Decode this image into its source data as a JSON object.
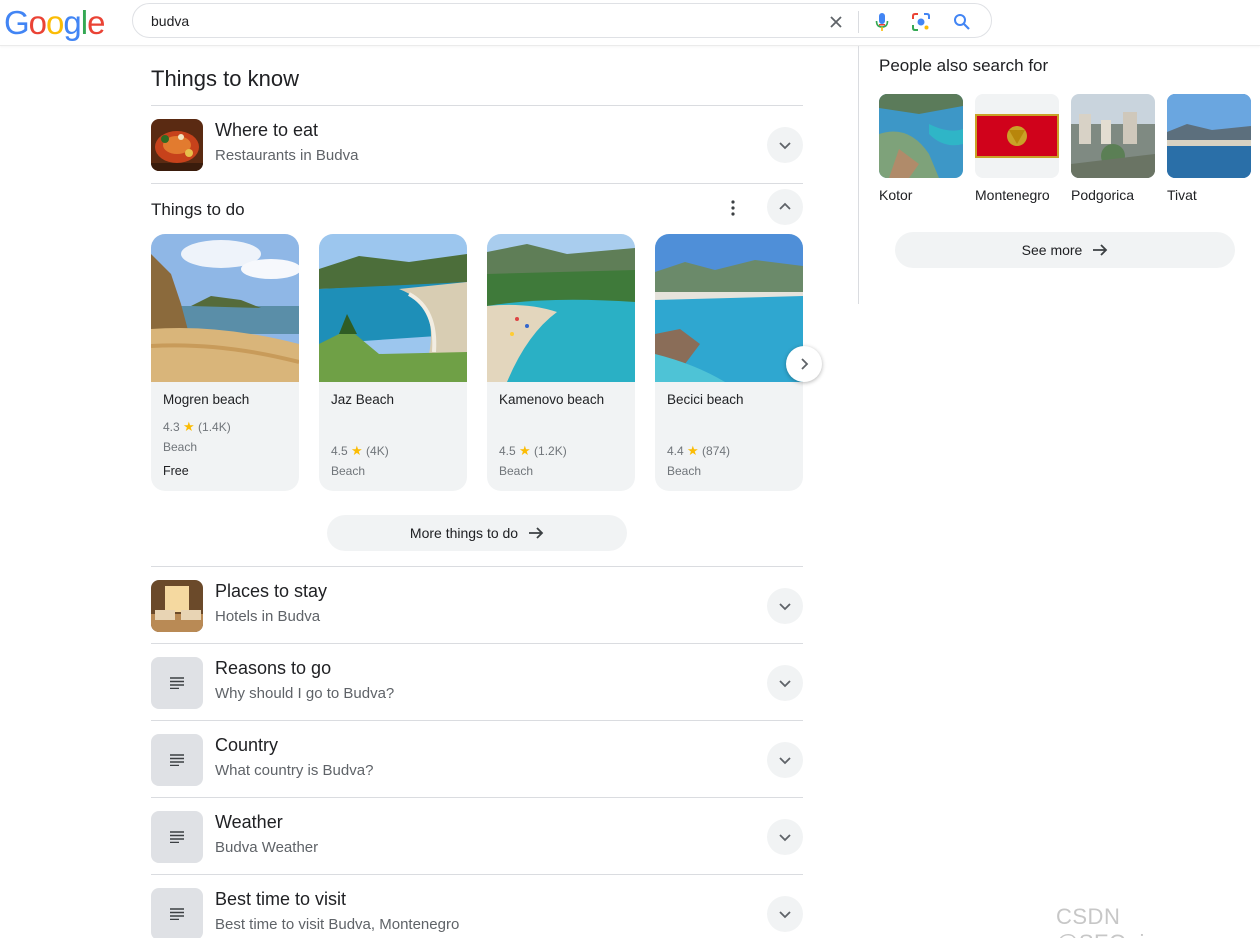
{
  "logo": [
    "G",
    "o",
    "o",
    "g",
    "l",
    "e"
  ],
  "search": {
    "query": "budva"
  },
  "main": {
    "title": "Things to know",
    "rows_top": [
      {
        "title": "Where to eat",
        "sub": "Restaurants in Budva"
      }
    ],
    "todo": {
      "title": "Things to do",
      "cards": [
        {
          "name": "Mogren beach",
          "rating": "4.3",
          "reviews": "(1.4K)",
          "type": "Beach",
          "price": "Free"
        },
        {
          "name": "Jaz Beach",
          "rating": "4.5",
          "reviews": "(4K)",
          "type": "Beach"
        },
        {
          "name": "Kamenovo beach",
          "rating": "4.5",
          "reviews": "(1.2K)",
          "type": "Beach"
        },
        {
          "name": "Becici beach",
          "rating": "4.4",
          "reviews": "(874)",
          "type": "Beach"
        }
      ],
      "more_label": "More things to do"
    },
    "rows_bottom": [
      {
        "title": "Places to stay",
        "sub": "Hotels in Budva"
      },
      {
        "title": "Reasons to go",
        "sub": "Why should I go to Budva?"
      },
      {
        "title": "Country",
        "sub": "What country is Budva?"
      },
      {
        "title": "Weather",
        "sub": "Budva Weather"
      },
      {
        "title": "Best time to visit",
        "sub": "Best time to visit Budva, Montenegro"
      }
    ]
  },
  "side": {
    "title": "People also search for",
    "items": [
      {
        "label": "Kotor"
      },
      {
        "label": "Montenegro"
      },
      {
        "label": "Podgorica"
      },
      {
        "label": "Tivat"
      }
    ],
    "see_more": "See more"
  },
  "watermark": "CSDN @SEO_juper",
  "colors": {
    "accent_blue": "#4285f4",
    "star": "#fbbc04",
    "chip_bg": "#f1f3f4"
  }
}
